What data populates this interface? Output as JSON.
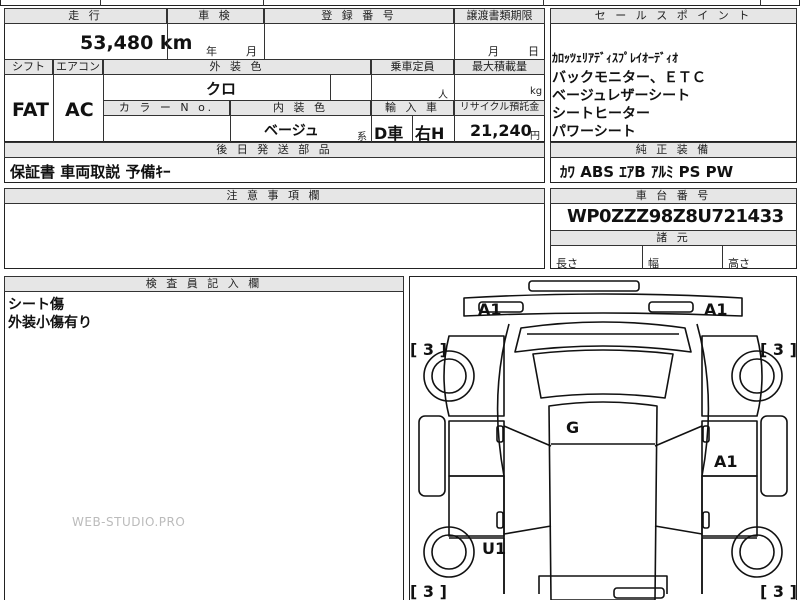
{
  "top_strip": {
    "partial": "自"
  },
  "mileage": {
    "label": "走 行",
    "value": "53,480 km"
  },
  "inspection": {
    "label": "車 検",
    "year": "年",
    "month": "月"
  },
  "registration": {
    "label": "登 録 番 号"
  },
  "transfer_deadline": {
    "label": "譲渡書類期限",
    "month": "月",
    "day": "日"
  },
  "shift": {
    "label": "シフト",
    "value": "FAT"
  },
  "aircon": {
    "label": "エアコン",
    "value": "AC"
  },
  "exterior_color": {
    "label": "外 装 色",
    "value": "クロ"
  },
  "capacity": {
    "label": "乗車定員",
    "unit": "人"
  },
  "max_load": {
    "label": "最大積載量",
    "unit": "kg"
  },
  "color_no": {
    "label": "カ ラ ー N o."
  },
  "interior_color": {
    "label": "内 装 色",
    "value": "ベージュ",
    "suffix": "系"
  },
  "import": {
    "label": "輸 入 車",
    "drive": "D車",
    "steer": "右H"
  },
  "recycle": {
    "label": "リサイクル預託金",
    "value": "21,240",
    "unit": "円"
  },
  "later_parts": {
    "label": "後 日 発 送 部 品",
    "value": "保証書 車両取説 予備ｷｰ"
  },
  "notes": {
    "label": "注 意 事 項 欄"
  },
  "sales_points": {
    "label": "セ ー ル ス ポ イ ン ト",
    "lines": [
      "ｶﾛｯﾂｪﾘｱﾃﾞｨｽﾌﾟﾚｲｵｰﾃﾞｨｵ",
      "バックモニター、ＥＴＣ",
      "ベージュレザーシート",
      "シートヒーター",
      "パワーシート"
    ]
  },
  "equipment": {
    "label": "純 正 装 備",
    "value": "ｶﾜ ABS ｴｱB ｱﾙﾐ PS PW"
  },
  "chassis": {
    "label": "車 台 番 号",
    "value": "WP0ZZZ98Z8U721433"
  },
  "dimensions": {
    "label": "諸 元",
    "length": "長さ",
    "width": "幅",
    "height": "高さ"
  },
  "inspector": {
    "label": "検 査 員 記 入 欄",
    "lines": [
      "シート傷",
      "外装小傷有り"
    ]
  },
  "watermark": "WEB-STUDIO.PRO",
  "diagram": {
    "marks": {
      "front_left": "A1",
      "front_right": "A1",
      "roof": "G",
      "right_side": "A1",
      "left_rear": "U1"
    },
    "bracket_value": "3",
    "bracket_open": "[",
    "bracket_close": "]"
  }
}
